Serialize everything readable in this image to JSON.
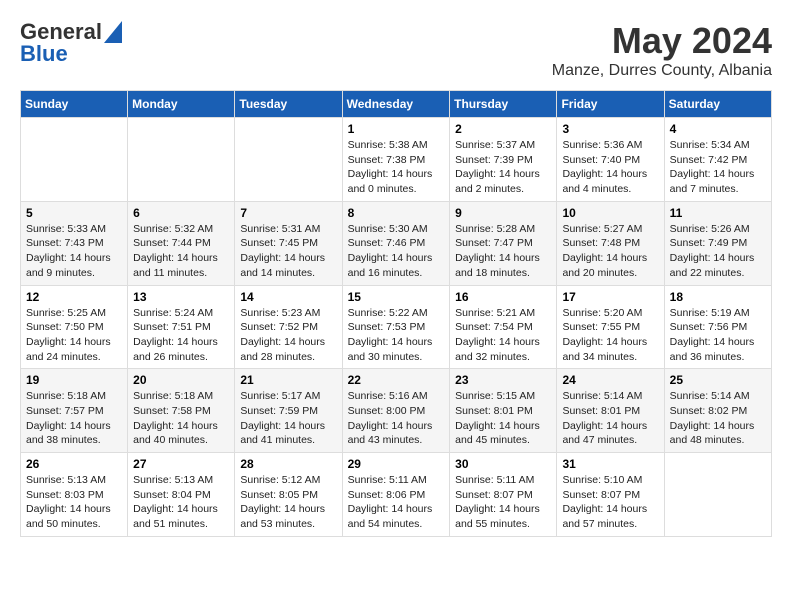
{
  "header": {
    "logo_line1": "General",
    "logo_line2": "Blue",
    "month": "May 2024",
    "location": "Manze, Durres County, Albania"
  },
  "weekdays": [
    "Sunday",
    "Monday",
    "Tuesday",
    "Wednesday",
    "Thursday",
    "Friday",
    "Saturday"
  ],
  "weeks": [
    [
      {
        "day": "",
        "info": ""
      },
      {
        "day": "",
        "info": ""
      },
      {
        "day": "",
        "info": ""
      },
      {
        "day": "1",
        "info": "Sunrise: 5:38 AM\nSunset: 7:38 PM\nDaylight: 14 hours\nand 0 minutes."
      },
      {
        "day": "2",
        "info": "Sunrise: 5:37 AM\nSunset: 7:39 PM\nDaylight: 14 hours\nand 2 minutes."
      },
      {
        "day": "3",
        "info": "Sunrise: 5:36 AM\nSunset: 7:40 PM\nDaylight: 14 hours\nand 4 minutes."
      },
      {
        "day": "4",
        "info": "Sunrise: 5:34 AM\nSunset: 7:42 PM\nDaylight: 14 hours\nand 7 minutes."
      }
    ],
    [
      {
        "day": "5",
        "info": "Sunrise: 5:33 AM\nSunset: 7:43 PM\nDaylight: 14 hours\nand 9 minutes."
      },
      {
        "day": "6",
        "info": "Sunrise: 5:32 AM\nSunset: 7:44 PM\nDaylight: 14 hours\nand 11 minutes."
      },
      {
        "day": "7",
        "info": "Sunrise: 5:31 AM\nSunset: 7:45 PM\nDaylight: 14 hours\nand 14 minutes."
      },
      {
        "day": "8",
        "info": "Sunrise: 5:30 AM\nSunset: 7:46 PM\nDaylight: 14 hours\nand 16 minutes."
      },
      {
        "day": "9",
        "info": "Sunrise: 5:28 AM\nSunset: 7:47 PM\nDaylight: 14 hours\nand 18 minutes."
      },
      {
        "day": "10",
        "info": "Sunrise: 5:27 AM\nSunset: 7:48 PM\nDaylight: 14 hours\nand 20 minutes."
      },
      {
        "day": "11",
        "info": "Sunrise: 5:26 AM\nSunset: 7:49 PM\nDaylight: 14 hours\nand 22 minutes."
      }
    ],
    [
      {
        "day": "12",
        "info": "Sunrise: 5:25 AM\nSunset: 7:50 PM\nDaylight: 14 hours\nand 24 minutes."
      },
      {
        "day": "13",
        "info": "Sunrise: 5:24 AM\nSunset: 7:51 PM\nDaylight: 14 hours\nand 26 minutes."
      },
      {
        "day": "14",
        "info": "Sunrise: 5:23 AM\nSunset: 7:52 PM\nDaylight: 14 hours\nand 28 minutes."
      },
      {
        "day": "15",
        "info": "Sunrise: 5:22 AM\nSunset: 7:53 PM\nDaylight: 14 hours\nand 30 minutes."
      },
      {
        "day": "16",
        "info": "Sunrise: 5:21 AM\nSunset: 7:54 PM\nDaylight: 14 hours\nand 32 minutes."
      },
      {
        "day": "17",
        "info": "Sunrise: 5:20 AM\nSunset: 7:55 PM\nDaylight: 14 hours\nand 34 minutes."
      },
      {
        "day": "18",
        "info": "Sunrise: 5:19 AM\nSunset: 7:56 PM\nDaylight: 14 hours\nand 36 minutes."
      }
    ],
    [
      {
        "day": "19",
        "info": "Sunrise: 5:18 AM\nSunset: 7:57 PM\nDaylight: 14 hours\nand 38 minutes."
      },
      {
        "day": "20",
        "info": "Sunrise: 5:18 AM\nSunset: 7:58 PM\nDaylight: 14 hours\nand 40 minutes."
      },
      {
        "day": "21",
        "info": "Sunrise: 5:17 AM\nSunset: 7:59 PM\nDaylight: 14 hours\nand 41 minutes."
      },
      {
        "day": "22",
        "info": "Sunrise: 5:16 AM\nSunset: 8:00 PM\nDaylight: 14 hours\nand 43 minutes."
      },
      {
        "day": "23",
        "info": "Sunrise: 5:15 AM\nSunset: 8:01 PM\nDaylight: 14 hours\nand 45 minutes."
      },
      {
        "day": "24",
        "info": "Sunrise: 5:14 AM\nSunset: 8:01 PM\nDaylight: 14 hours\nand 47 minutes."
      },
      {
        "day": "25",
        "info": "Sunrise: 5:14 AM\nSunset: 8:02 PM\nDaylight: 14 hours\nand 48 minutes."
      }
    ],
    [
      {
        "day": "26",
        "info": "Sunrise: 5:13 AM\nSunset: 8:03 PM\nDaylight: 14 hours\nand 50 minutes."
      },
      {
        "day": "27",
        "info": "Sunrise: 5:13 AM\nSunset: 8:04 PM\nDaylight: 14 hours\nand 51 minutes."
      },
      {
        "day": "28",
        "info": "Sunrise: 5:12 AM\nSunset: 8:05 PM\nDaylight: 14 hours\nand 53 minutes."
      },
      {
        "day": "29",
        "info": "Sunrise: 5:11 AM\nSunset: 8:06 PM\nDaylight: 14 hours\nand 54 minutes."
      },
      {
        "day": "30",
        "info": "Sunrise: 5:11 AM\nSunset: 8:07 PM\nDaylight: 14 hours\nand 55 minutes."
      },
      {
        "day": "31",
        "info": "Sunrise: 5:10 AM\nSunset: 8:07 PM\nDaylight: 14 hours\nand 57 minutes."
      },
      {
        "day": "",
        "info": ""
      }
    ]
  ]
}
